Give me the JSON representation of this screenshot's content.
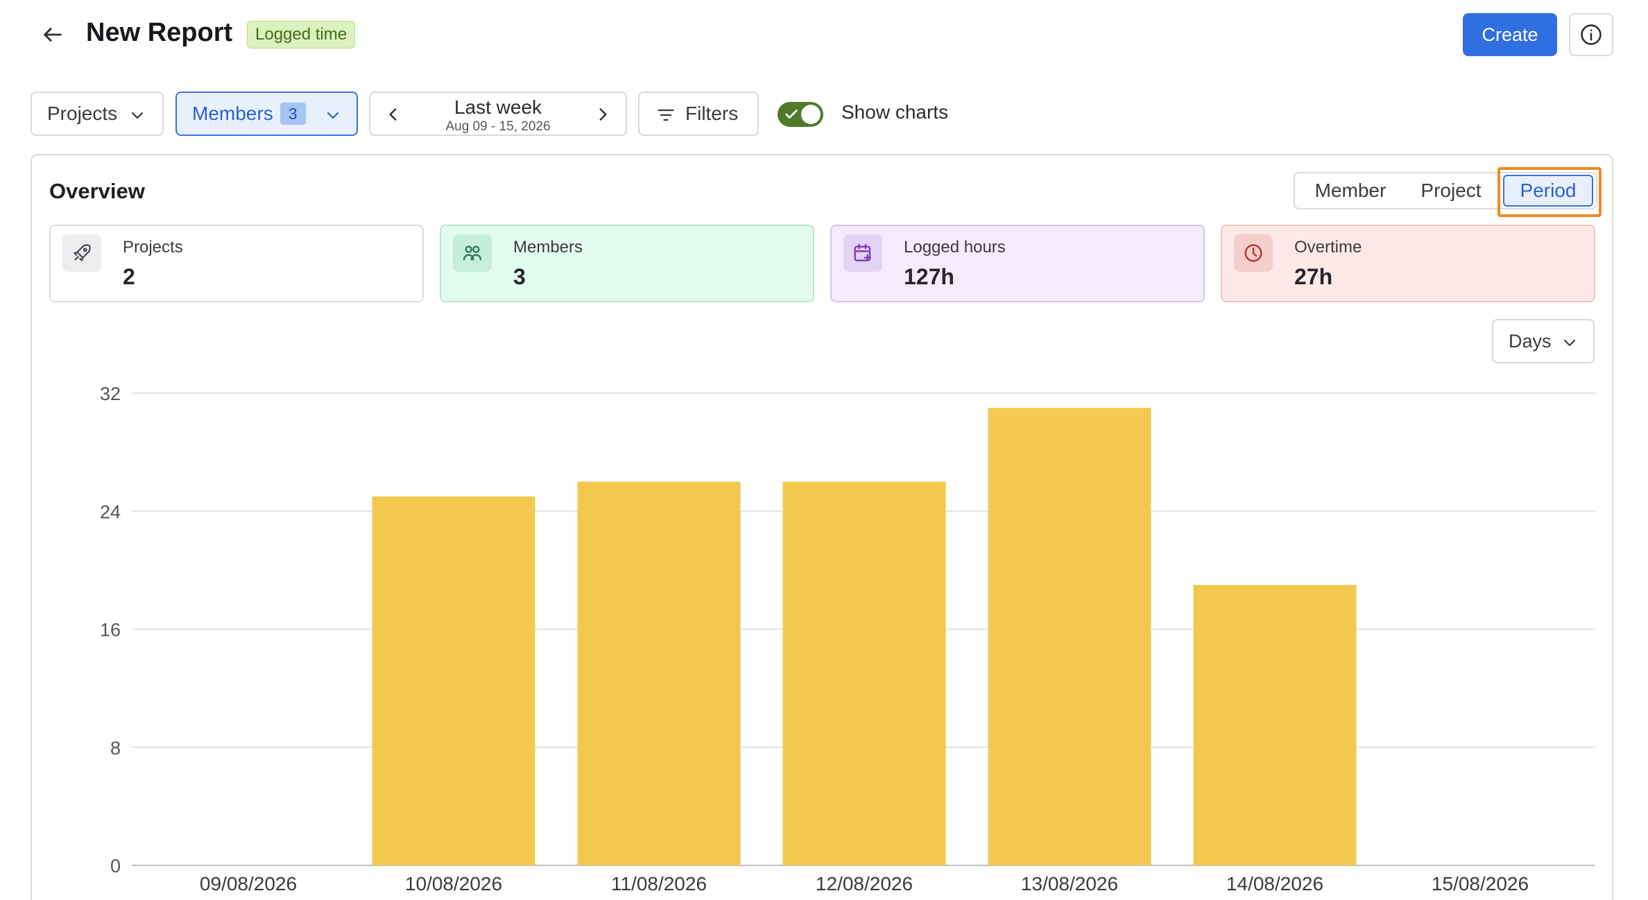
{
  "header": {
    "title": "New Report",
    "tag": "Logged time",
    "create_label": "Create"
  },
  "toolbar": {
    "projects_label": "Projects",
    "members_label": "Members",
    "members_count": "3",
    "period_main": "Last week",
    "period_sub": "Aug 09 - 15, 2026",
    "filters_label": "Filters",
    "show_charts_label": "Show charts",
    "show_charts_on": true
  },
  "overview": {
    "title": "Overview",
    "segments": [
      "Member",
      "Project",
      "Period"
    ],
    "active_segment": "Period",
    "cards": [
      {
        "label": "Projects",
        "value": "2",
        "icon": "rocket-icon"
      },
      {
        "label": "Members",
        "value": "3",
        "icon": "users-icon"
      },
      {
        "label": "Logged hours",
        "value": "127h",
        "icon": "calendar-plus-icon"
      },
      {
        "label": "Overtime",
        "value": "27h",
        "icon": "clock-icon"
      }
    ],
    "granularity_label": "Days"
  },
  "colors": {
    "primary": "#2f6fe0",
    "bar": "#f2c84f",
    "highlight": "#f08a24",
    "toggle": "#4f7a2a"
  },
  "chart_data": {
    "type": "bar",
    "categories": [
      "09/08/2026",
      "10/08/2026",
      "11/08/2026",
      "12/08/2026",
      "13/08/2026",
      "14/08/2026",
      "15/08/2026"
    ],
    "values": [
      0,
      25,
      26,
      26,
      31,
      19,
      0
    ],
    "yticks": [
      0,
      8,
      16,
      24,
      32
    ],
    "ylim": [
      0,
      32
    ],
    "grid": true
  }
}
